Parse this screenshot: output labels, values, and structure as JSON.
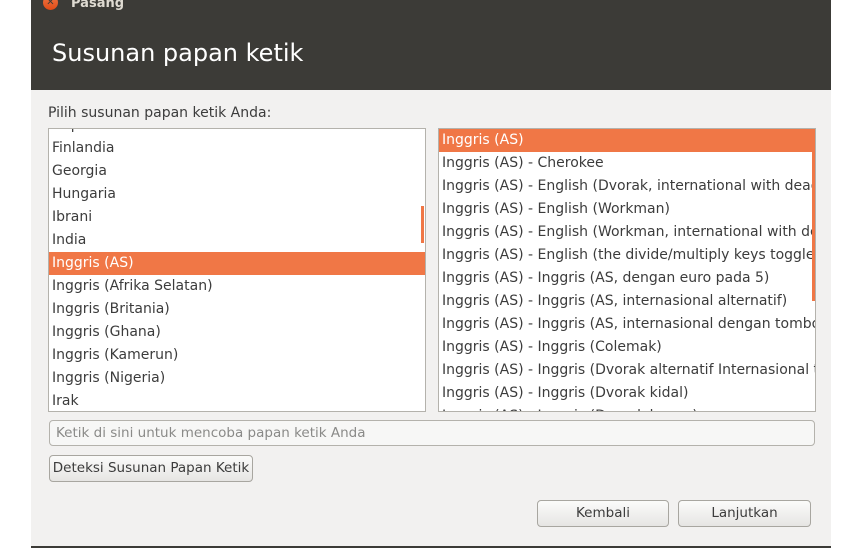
{
  "window": {
    "title": "Pasang",
    "heading": "Susunan papan ketik"
  },
  "prompt": "Pilih susunan papan ketik Anda:",
  "layouts": {
    "items": [
      "Filipina",
      "Finlandia",
      "Georgia",
      "Hungaria",
      "Ibrani",
      "India",
      "Inggris (AS)",
      "Inggris (Afrika Selatan)",
      "Inggris (Britania)",
      "Inggris (Ghana)",
      "Inggris (Kamerun)",
      "Inggris (Nigeria)",
      "Irak"
    ],
    "selected": "Inggris (AS)"
  },
  "variants": {
    "items": [
      "Inggris (AS)",
      "Inggris (AS) - Cherokee",
      "Inggris (AS) - English (Dvorak, international with dead keys)",
      "Inggris (AS) - English (Workman)",
      "Inggris (AS) - English (Workman, international with dead keys)",
      "Inggris (AS) - English (the divide/multiply keys toggle the layout)",
      "Inggris (AS) - Inggris (AS, dengan euro pada 5)",
      "Inggris (AS) - Inggris (AS, internasional alternatif)",
      "Inggris (AS) - Inggris (AS, internasional dengan tombol mati)",
      "Inggris (AS) - Inggris (Colemak)",
      "Inggris (AS) - Inggris (Dvorak alternatif Internasional tanpa tombol mati)",
      "Inggris (AS) - Inggris (Dvorak kidal)",
      "Inggris (AS) - Inggris (Dvorak kanan)"
    ],
    "selected": "Inggris (AS)"
  },
  "test_input": {
    "placeholder": "Ketik di sini untuk mencoba papan ketik Anda",
    "value": ""
  },
  "buttons": {
    "detect": "Deteksi Susunan Papan Ketik",
    "back": "Kembali",
    "next": "Lanjutkan"
  },
  "icons": {
    "close": "close-icon"
  },
  "colors": {
    "accent": "#f07746",
    "header_bg": "#3c3b37",
    "content_bg": "#f2f1f0"
  }
}
